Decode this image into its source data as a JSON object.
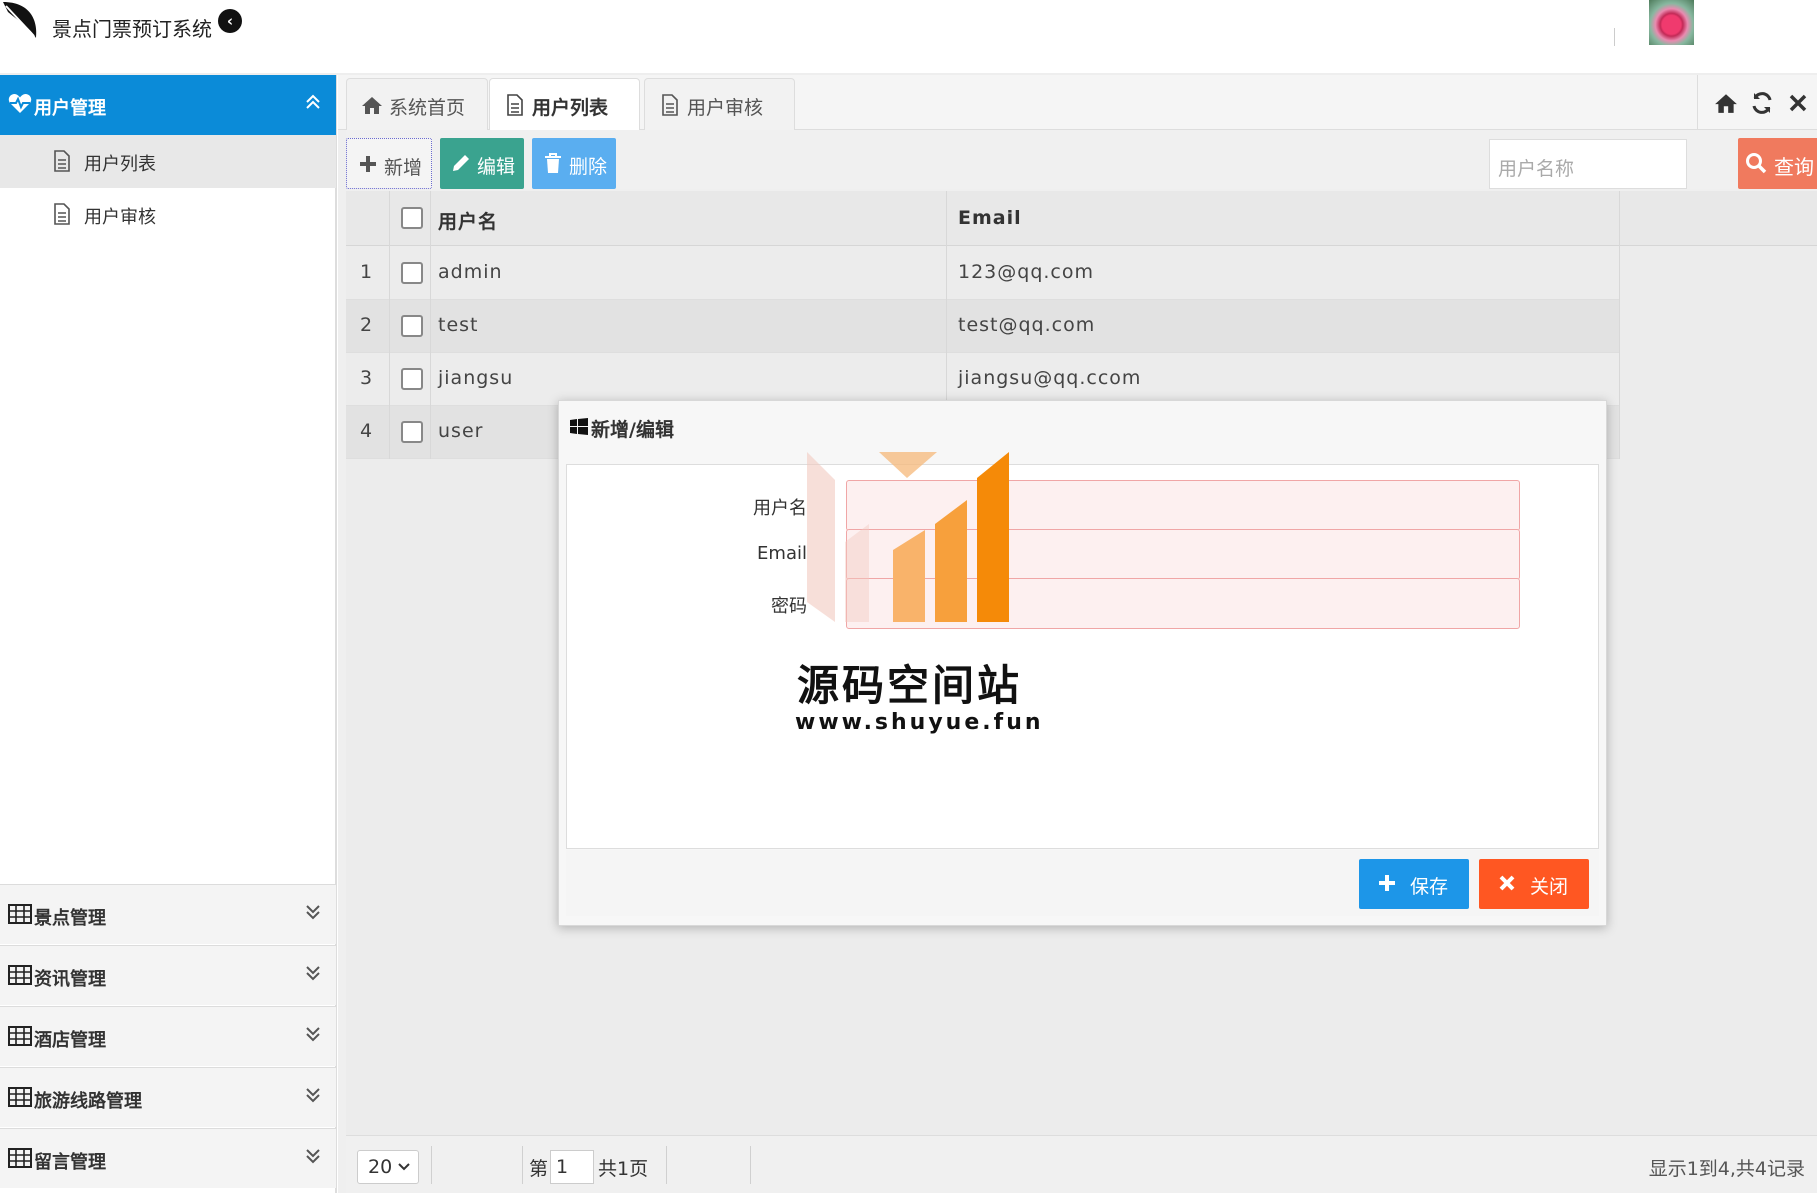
{
  "header": {
    "app_title": "景点门票预订系统"
  },
  "sidebar": {
    "active_menu": "用户管理",
    "sub_items": [
      {
        "label": "用户列表"
      },
      {
        "label": "用户审核"
      }
    ],
    "collapsed_menus": [
      {
        "label": "景点管理"
      },
      {
        "label": "资讯管理"
      },
      {
        "label": "酒店管理"
      },
      {
        "label": "旅游线路管理"
      },
      {
        "label": "留言管理"
      }
    ]
  },
  "tabs": [
    {
      "label": "系统首页",
      "icon": "home-icon"
    },
    {
      "label": "用户列表",
      "icon": "file-icon"
    },
    {
      "label": "用户审核",
      "icon": "file-icon"
    }
  ],
  "toolbar": {
    "add_label": "新增",
    "edit_label": "编辑",
    "delete_label": "删除",
    "search_placeholder": "用户名称",
    "search_label": "查询"
  },
  "table": {
    "columns": [
      "用户名",
      "Email"
    ],
    "rows": [
      {
        "num": "1",
        "username": "admin",
        "email": "123@qq.com"
      },
      {
        "num": "2",
        "username": "test",
        "email": "test@qq.com"
      },
      {
        "num": "3",
        "username": "jiangsu",
        "email": "jiangsu@qq.ccom"
      },
      {
        "num": "4",
        "username": "user",
        "email": ""
      }
    ]
  },
  "pager": {
    "page_size": "20",
    "page_prefix": "第",
    "page_value": "1",
    "page_suffix": "共1页",
    "info": "显示1到4,共4记录"
  },
  "dialog": {
    "title": "新增/编辑",
    "fields": [
      {
        "label": "用户名"
      },
      {
        "label": "Email"
      },
      {
        "label": "密码"
      }
    ],
    "save_label": "保存",
    "close_label": "关闭"
  },
  "watermark": {
    "title": "源码空间站",
    "url": "www.shuyue.fun"
  },
  "colors": {
    "sidebar_active": "#0b8bd8",
    "edit_button": "#3aa38f",
    "delete_button": "#5aaef0",
    "search_button": "#f07a5e",
    "save_button": "#1d96e8",
    "close_button": "#ff5722"
  }
}
